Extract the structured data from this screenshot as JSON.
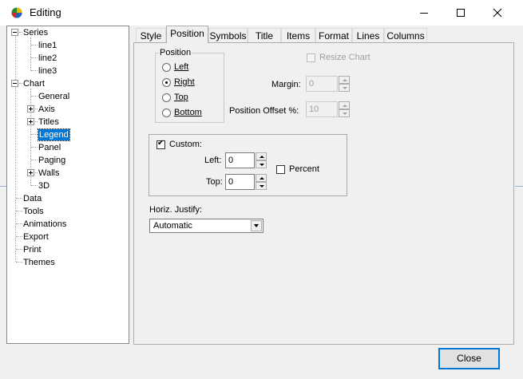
{
  "window": {
    "title": "Editing",
    "close_label": "Close"
  },
  "tree": {
    "series": {
      "label": "Series",
      "children": [
        "line1",
        "line2",
        "line3"
      ]
    },
    "chart": {
      "label": "Chart",
      "children": [
        "General",
        "Axis",
        "Titles",
        "Legend",
        "Panel",
        "Paging",
        "Walls",
        "3D"
      ],
      "selected": "Legend"
    },
    "root_items": [
      "Data",
      "Tools",
      "Animations",
      "Export",
      "Print",
      "Themes"
    ]
  },
  "tabs": {
    "items": [
      "Style",
      "Position",
      "Symbols",
      "Title",
      "Items",
      "Format",
      "Lines",
      "Columns"
    ],
    "active": "Position"
  },
  "position_group": {
    "title": "Position",
    "options": [
      "Left",
      "Right",
      "Top",
      "Bottom"
    ],
    "selected": "Right"
  },
  "resize_chart": {
    "label": "Resize Chart",
    "checked": false,
    "enabled": false
  },
  "margin": {
    "label": "Margin:",
    "value": "0",
    "enabled": false
  },
  "position_offset": {
    "label": "Position Offset %:",
    "value": "10",
    "enabled": false
  },
  "custom": {
    "label": "Custom:",
    "checked": true,
    "left_label": "Left:",
    "left_value": "0",
    "top_label": "Top:",
    "top_value": "0",
    "percent_label": "Percent",
    "percent_checked": false
  },
  "horiz_justify": {
    "label": "Horiz. Justify:",
    "value": "Automatic"
  }
}
